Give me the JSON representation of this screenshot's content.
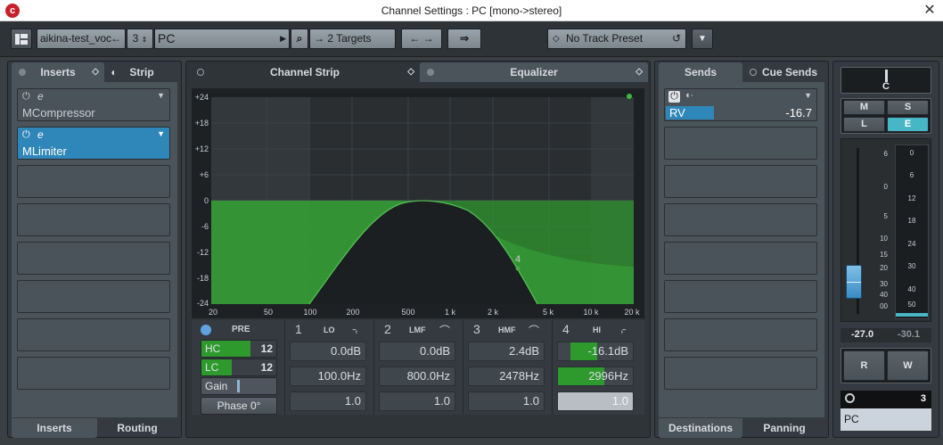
{
  "window": {
    "title": "Channel Settings : PC [mono->stereo]",
    "logo": "c",
    "close": "✕"
  },
  "toolbar": {
    "track_name": "aikina-test_voc",
    "track_number": "3",
    "channel_name": "PC",
    "targets": "2 Targets",
    "preset": "No Track Preset"
  },
  "inserts": {
    "tabs": [
      "Inserts",
      "Strip"
    ],
    "bottom_tabs": [
      "Inserts",
      "Routing"
    ],
    "plugins": [
      {
        "name": "MCompressor",
        "active": false
      },
      {
        "name": "MLimiter",
        "active": true
      }
    ],
    "empty_slots": 6
  },
  "center": {
    "tabs": [
      "Channel Strip",
      "Equalizer"
    ]
  },
  "eq": {
    "db_labels": [
      "+24",
      "+18",
      "+12",
      "+6",
      "0",
      "-6",
      "-12",
      "-18",
      "-24"
    ],
    "freq_labels": [
      "20",
      "50",
      "100",
      "200",
      "500",
      "1 k",
      "2 k",
      "5 k",
      "10 k",
      "20 k"
    ],
    "band_marker": "4",
    "pre": {
      "label": "PRE",
      "hc": "HC",
      "lc": "LC",
      "hc_value": "12",
      "lc_value": "12",
      "gain": "Gain",
      "phase": "Phase 0°"
    },
    "bands": [
      {
        "num": "1",
        "name": "LO",
        "gain": "0.0dB",
        "freq": "100.0Hz",
        "q": "1.0"
      },
      {
        "num": "2",
        "name": "LMF",
        "gain": "0.0dB",
        "freq": "800.0Hz",
        "q": "1.0"
      },
      {
        "num": "3",
        "name": "HMF",
        "gain": "2.4dB",
        "freq": "2478Hz",
        "q": "1.0"
      },
      {
        "num": "4",
        "name": "HI",
        "gain": "-16.1dB",
        "freq": "2996Hz",
        "q": "1.0"
      }
    ]
  },
  "sends": {
    "tabs": [
      "Sends",
      "Cue Sends"
    ],
    "bottom_tabs": [
      "Destinations",
      "Panning"
    ],
    "items": [
      {
        "name": "RV",
        "level": "-16.7"
      }
    ],
    "empty_slots": 7
  },
  "fader": {
    "pan": "C",
    "buttons": [
      "M",
      "S",
      "L",
      "E"
    ],
    "fader_scale": [
      "6",
      "0",
      "5",
      "10",
      "15",
      "20",
      "30",
      "40",
      "00"
    ],
    "meter_scale": [
      "0",
      "6",
      "12",
      "18",
      "24",
      "30",
      "40",
      "50"
    ],
    "level": "-27.0",
    "peak": "-30.1",
    "rw": [
      "R",
      "W"
    ],
    "channel_number": "3",
    "channel_name": "PC"
  },
  "colors": {
    "accent": "#2f86b8",
    "eq_green": "#2f9e2f",
    "bg": "#343a3f"
  }
}
